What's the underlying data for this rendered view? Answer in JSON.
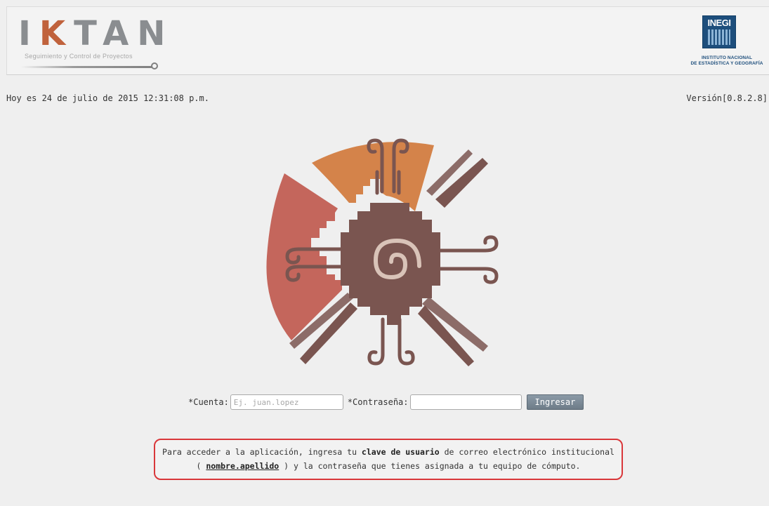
{
  "header": {
    "logo_text_a": "I",
    "logo_text_b": "K",
    "logo_text_c": "TAN",
    "logo_subtitle": "Seguimiento y Control de Proyectos",
    "inegi_acronym": "INEGI",
    "inegi_line1": "INSTITUTO NACIONAL",
    "inegi_line2": "DE ESTADÍSTICA Y GEOGRAFÍA"
  },
  "status": {
    "date_text": "Hoy es 24 de julio de 2015 12:31:08 p.m.",
    "version_text": "Versión[0.8.2.8]"
  },
  "login": {
    "account_label": "*Cuenta:",
    "account_value": "",
    "account_placeholder": "Ej. juan.lopez",
    "password_label": "*Contraseña:",
    "password_value": "",
    "submit_label": "Ingresar"
  },
  "notice": {
    "part1": "Para acceder a la aplicación, ingresa tu ",
    "bold1": "clave de usuario",
    "part2": " de correo electrónico institucional",
    "part3": "( ",
    "underlined": "nombre.apellido",
    "part4": " ) y la contraseña que tienes asignada a tu equipo de cómputo."
  },
  "colors": {
    "background": "#efefef",
    "emblem_orange": "#d4834a",
    "emblem_red": "#c4665c",
    "emblem_brown": "#7a5550",
    "notice_border": "#d9373a",
    "button": "#7a8894",
    "inegi_blue": "#1d4e7c"
  }
}
